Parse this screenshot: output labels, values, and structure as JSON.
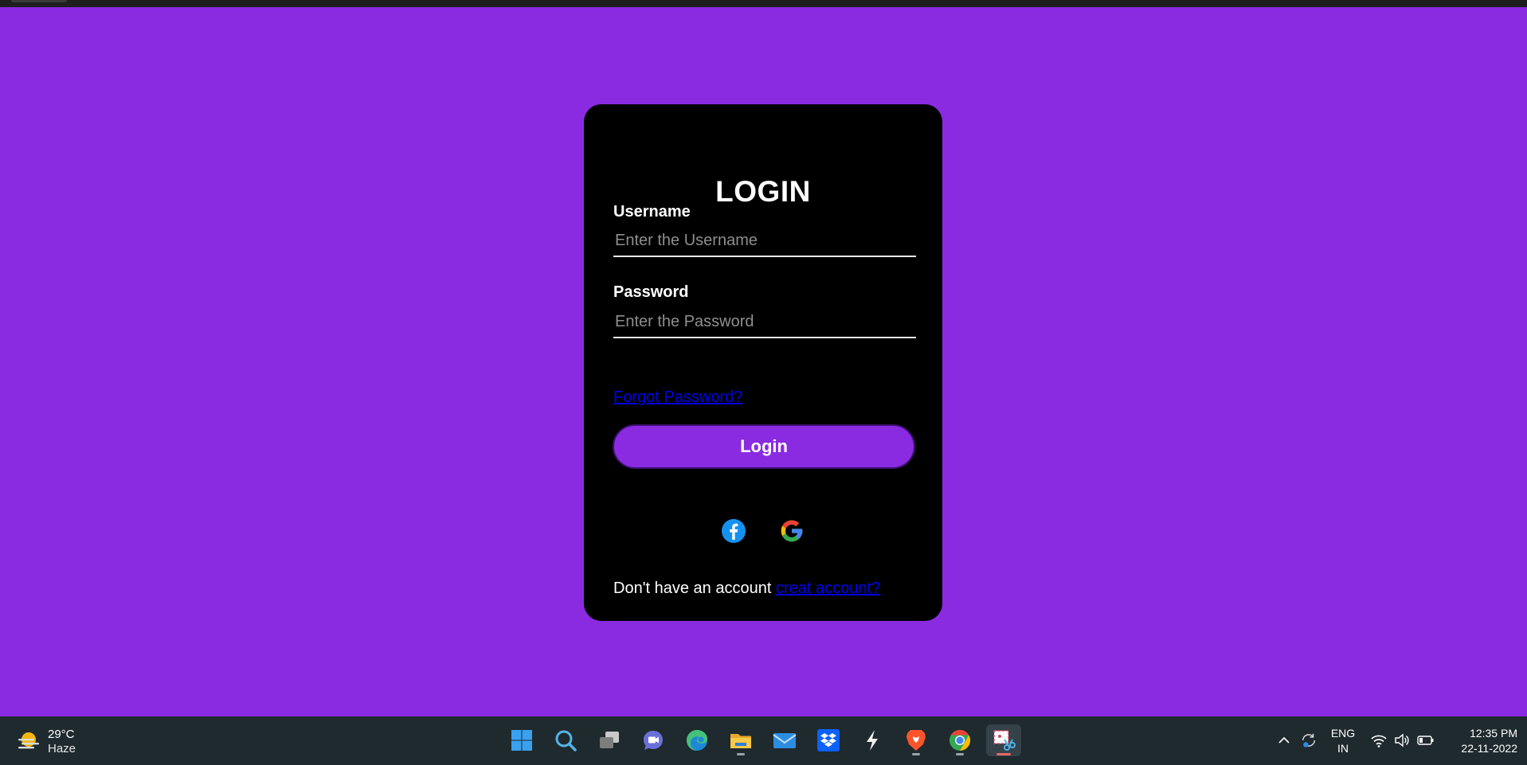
{
  "colors": {
    "page_background": "#8a2be2",
    "card_background": "#000000",
    "link": "#0000ee",
    "button_background": "#8a2be2",
    "taskbar_background": "#1f2a2e"
  },
  "login_form": {
    "title": "LOGIN",
    "username_label": "Username",
    "username_placeholder": "Enter the Username",
    "username_value": "",
    "password_label": "Password",
    "password_placeholder": "Enter the Password",
    "password_value": "",
    "forgot_password_link": "Forgot Password?",
    "login_button": "Login",
    "social_icons": [
      "facebook-icon",
      "google-icon"
    ],
    "signup_prompt": "Don't have an account",
    "signup_link": "creat account?"
  },
  "taskbar": {
    "weather": {
      "temperature": "29°C",
      "condition": "Haze",
      "icon": "haze-weather-icon"
    },
    "pinned_apps": [
      "windows-start-icon",
      "search-icon",
      "task-view-icon",
      "teams-chat-icon",
      "edge-browser-icon",
      "file-explorer-icon",
      "mail-icon",
      "dropbox-icon",
      "zap-app-icon",
      "brave-browser-icon",
      "chrome-browser-icon",
      "snipping-tool-icon"
    ],
    "tray_icons": [
      "chevron-up-icon",
      "sync-icon",
      "wifi-icon",
      "volume-icon",
      "battery-icon"
    ],
    "language_line1": "ENG",
    "language_line2": "IN",
    "time": "12:35 PM",
    "date": "22-11-2022"
  }
}
